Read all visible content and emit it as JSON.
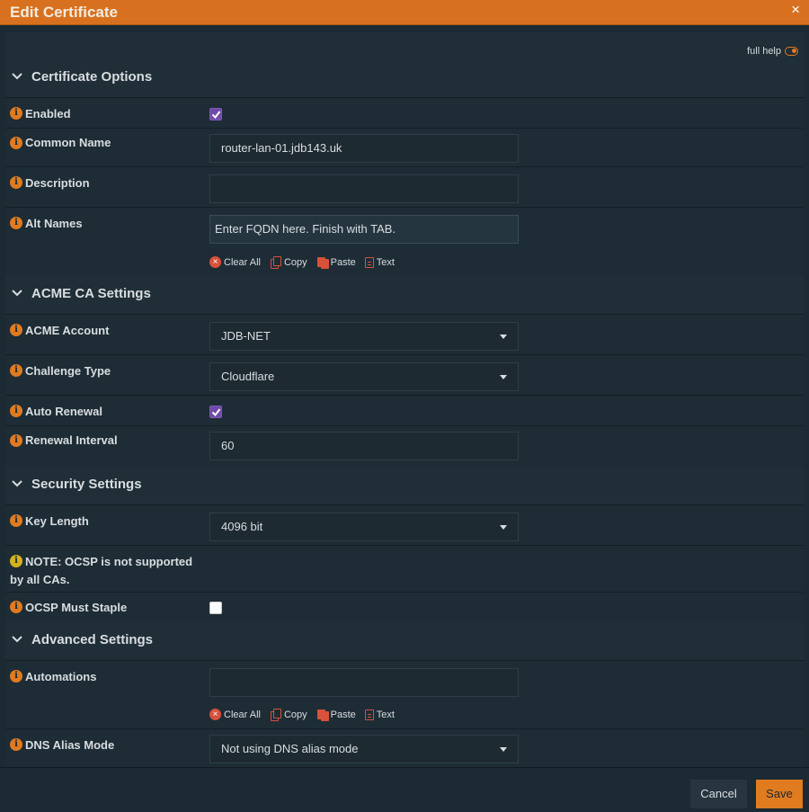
{
  "dialog": {
    "title": "Edit Certificate",
    "close_glyph": "×",
    "full_help_label": "full help"
  },
  "sections": {
    "certificate_options": "Certificate Options",
    "acme_ca_settings": "ACME CA Settings",
    "security_settings": "Security Settings",
    "advanced_settings": "Advanced Settings"
  },
  "fields": {
    "enabled": {
      "label": "Enabled",
      "checked": true
    },
    "common_name": {
      "label": "Common Name",
      "value": "router-lan-01.jdb143.uk"
    },
    "description": {
      "label": "Description",
      "value": ""
    },
    "alt_names": {
      "label": "Alt Names",
      "placeholder": "Enter FQDN here. Finish with TAB."
    },
    "acme_account": {
      "label": "ACME Account",
      "value": "JDB-NET"
    },
    "challenge_type": {
      "label": "Challenge Type",
      "value": "Cloudflare"
    },
    "auto_renewal": {
      "label": "Auto Renewal",
      "checked": true
    },
    "renewal_interval": {
      "label": "Renewal Interval",
      "value": "60"
    },
    "key_length": {
      "label": "Key Length",
      "value": "4096 bit"
    },
    "ocsp_note": {
      "label": "NOTE: OCSP is not supported by all CAs."
    },
    "ocsp_must_staple": {
      "label": "OCSP Must Staple",
      "checked": false
    },
    "automations": {
      "label": "Automations",
      "value": ""
    },
    "dns_alias_mode": {
      "label": "DNS Alias Mode",
      "value": "Not using DNS alias mode"
    }
  },
  "tokenizer_tools": {
    "clear_all": "Clear All",
    "copy": "Copy",
    "paste": "Paste",
    "text": "Text"
  },
  "footer": {
    "cancel_label": "Cancel",
    "save_label": "Save"
  },
  "colors": {
    "accent": "#e07b20",
    "background": "#1b2a33",
    "checkbox": "#6f4aa8",
    "tool_icon": "#d7513b"
  }
}
